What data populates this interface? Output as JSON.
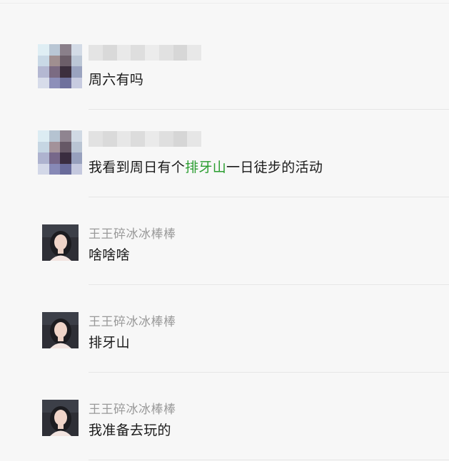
{
  "messages": [
    {
      "sender_name": "",
      "text": "周六有吗",
      "avatar": "pixelated-avatar"
    },
    {
      "sender_name": "",
      "text_before": "我看到周日有个",
      "text_link": "排牙山",
      "text_after": "一日徒步的活动",
      "avatar": "pixelated-avatar"
    },
    {
      "sender_name": "王王碎冰冰棒棒",
      "text": "啥啥啥",
      "avatar": "girl-photo-avatar"
    },
    {
      "sender_name": "王王碎冰冰棒棒",
      "text": "排牙山",
      "avatar": "girl-photo-avatar"
    },
    {
      "sender_name": "王王碎冰冰棒棒",
      "text": "我准备去玩的",
      "avatar": "girl-photo-avatar"
    }
  ],
  "colors": {
    "background": "#f7f7f7",
    "divider": "#e6e6e6",
    "name_text": "#999999",
    "message_text": "#191919",
    "link_text": "#2a9d2f"
  }
}
